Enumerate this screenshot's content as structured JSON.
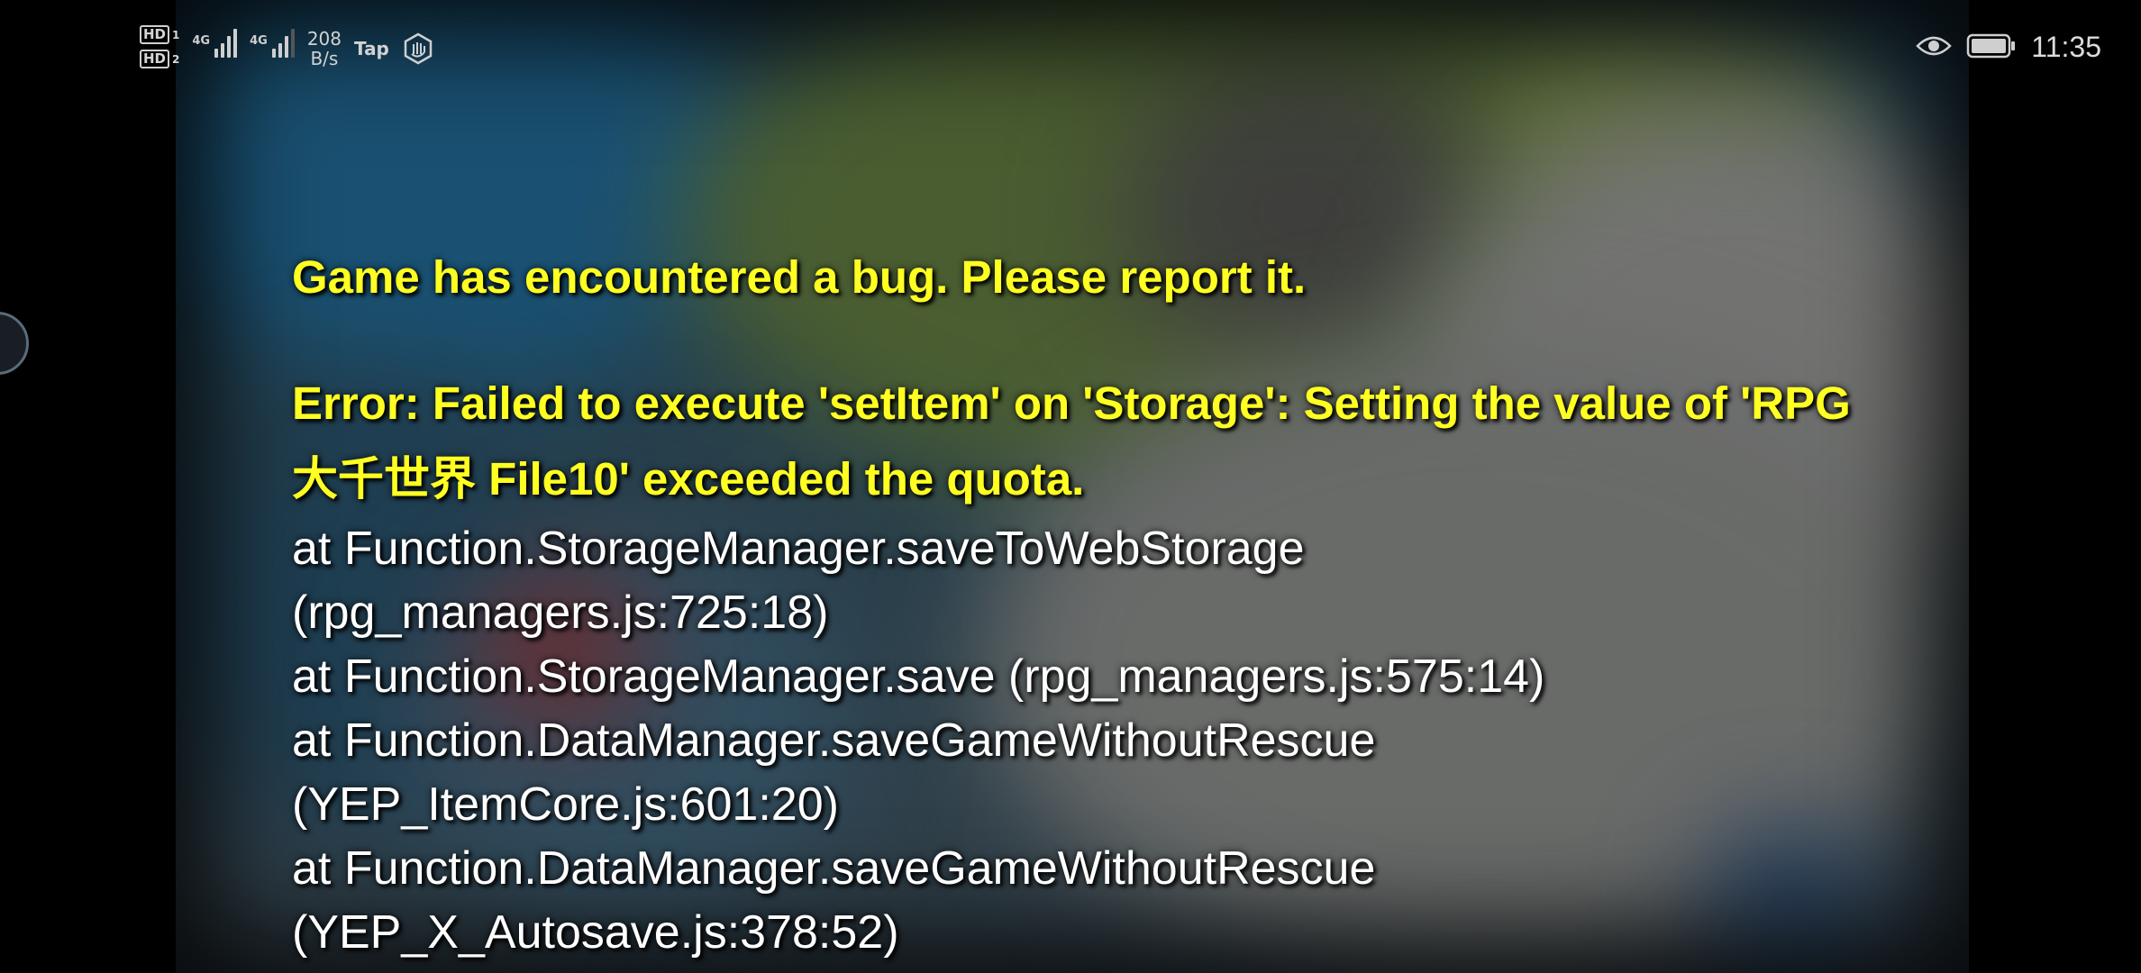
{
  "status_bar": {
    "hd1": "HD",
    "hd1_sub": "1",
    "hd2": "HD",
    "hd2_sub": "2",
    "signal1_label": "4G",
    "signal2_label": "4G",
    "net_speed_value": "208",
    "net_speed_unit": "B/s",
    "tap_label": "Tap",
    "time": "11:35",
    "icons": [
      "eye-icon",
      "battery-icon",
      "hand-icon"
    ]
  },
  "error": {
    "title": "Game has encountered a bug. Please report it.",
    "message": "Error: Failed to execute 'setItem' on 'Storage': Setting the value of 'RPG 大千世界 File10' exceeded the quota.",
    "stack": [
      "at Function.StorageManager.saveToWebStorage",
      "(rpg_managers.js:725:18)",
      "at Function.StorageManager.save (rpg_managers.js:575:14)",
      "at Function.DataManager.saveGameWithoutRescue",
      "(YEP_ItemCore.js:601:20)",
      "at Function.DataManager.saveGameWithoutRescue",
      "(YEP_X_Autosave.js:378:52)"
    ]
  },
  "colors": {
    "title_text": "#ffff22",
    "stack_text": "#ffffff",
    "background": "#000000"
  }
}
